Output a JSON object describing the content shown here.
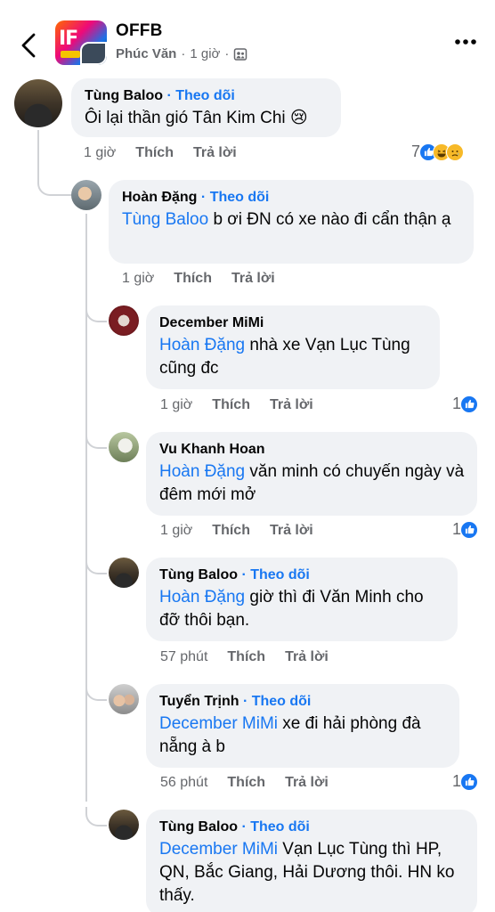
{
  "header": {
    "group_name": "OFFB",
    "author": "Phúc Văn",
    "separator": "·",
    "time": "1 giờ",
    "avatar_text": "IF"
  },
  "comments": [
    {
      "name": "Tùng Baloo",
      "follow": "Theo dõi",
      "mention": "",
      "text": "Ôi lại thần gió Tân Kim Chi 😢",
      "time": "1 giờ",
      "like": "Thích",
      "reply": "Trả lời",
      "reaction_count": "7"
    },
    {
      "name": "Hoàn Đặng",
      "follow": "Theo dõi",
      "mention": "Tùng Baloo",
      "text": " b ơi ĐN có xe nào đi cẩn thận ạ",
      "time": "1 giờ",
      "like": "Thích",
      "reply": "Trả lời",
      "reaction_count": ""
    },
    {
      "name": "December MiMi",
      "follow": "",
      "mention": "Hoàn Đặng",
      "text": " nhà xe Vạn Lục Tùng cũng đc",
      "time": "1 giờ",
      "like": "Thích",
      "reply": "Trả lời",
      "reaction_count": "1"
    },
    {
      "name": "Vu Khanh Hoan",
      "follow": "",
      "mention": "Hoàn Đặng",
      "text": " văn minh có chuyến ngày và đêm mới mở",
      "time": "1 giờ",
      "like": "Thích",
      "reply": "Trả lời",
      "reaction_count": "1"
    },
    {
      "name": "Tùng Baloo",
      "follow": "Theo dõi",
      "mention": "Hoàn Đặng",
      "text": " giờ thì đi Văn Minh cho đỡ thôi bạn.",
      "time": "57 phút",
      "like": "Thích",
      "reply": "Trả lời",
      "reaction_count": ""
    },
    {
      "name": "Tuyển Trịnh",
      "follow": "Theo dõi",
      "mention": "December MiMi",
      "text": " xe đi hải phòng đà nẵng à b",
      "time": "56 phút",
      "like": "Thích",
      "reply": "Trả lời",
      "reaction_count": "1"
    },
    {
      "name": "Tùng Baloo",
      "follow": "Theo dõi",
      "mention": "December MiMi",
      "text": " Vạn Lục Tùng thì HP, QN, Bắc Giang, Hải Dương thôi. HN ko thấy.",
      "time": "",
      "like": "",
      "reply": "",
      "reaction_count": ""
    }
  ],
  "icons": {
    "back": "chevron-left-icon",
    "more": "more-dots-icon",
    "audience": "members-icon",
    "like": "like-reaction-icon",
    "haha": "haha-reaction-icon",
    "sad": "sad-reaction-icon"
  },
  "colors": {
    "link": "#1877f2",
    "bubble": "#f0f2f5",
    "meta": "#65676b"
  }
}
